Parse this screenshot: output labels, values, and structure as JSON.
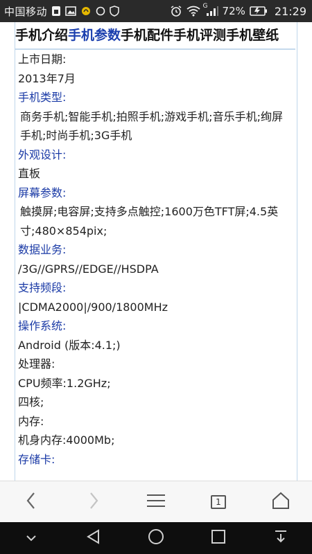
{
  "status_bar": {
    "carrier": "中国移动",
    "battery_percent": "72%",
    "time": "21:29",
    "network": "G",
    "icons": [
      "sim-icon",
      "gallery-icon",
      "app-icon",
      "circle-icon",
      "shield-icon",
      "alarm-icon",
      "wifi-icon",
      "signal-icon",
      "battery-icon"
    ]
  },
  "top_nav": {
    "items": [
      {
        "label": "手机介绍",
        "active": false
      },
      {
        "label": "手机参数",
        "active": true
      },
      {
        "label": "手机配件",
        "active": false
      },
      {
        "label": "手机评测",
        "active": false
      },
      {
        "label": "手机壁纸",
        "active": false
      }
    ]
  },
  "specs": [
    {
      "label": "上市日期:",
      "label_style": "plain",
      "value": "2013年7月"
    },
    {
      "label": "手机类型:",
      "label_style": "blue",
      "value": "商务手机;智能手机;拍照手机;游戏手机;音乐手机;绚屏手机;时尚手机;3G手机"
    },
    {
      "label": "外观设计:",
      "label_style": "blue",
      "value": "直板"
    },
    {
      "label": "屏幕参数:",
      "label_style": "blue",
      "value": "触摸屏;电容屏;支持多点触控;1600万色TFT屏;4.5英寸;480×854pix;"
    },
    {
      "label": "数据业务:",
      "label_style": "blue",
      "value": "/3G//GPRS//EDGE//HSDPA"
    },
    {
      "label": "支持频段:",
      "label_style": "blue",
      "value": "|CDMA2000|/900/1800MHz"
    },
    {
      "label": "操作系统:",
      "label_style": "blue",
      "value": "Android (版本:4.1;)"
    },
    {
      "label": "处理器:",
      "label_style": "plain",
      "value": "CPU频率:1.2GHz;"
    },
    {
      "label": "",
      "label_style": "plain",
      "value": "四核;"
    },
    {
      "label": "内存:",
      "label_style": "plain",
      "value": "机身内存:4000Mb;"
    },
    {
      "label": "存储卡:",
      "label_style": "blue",
      "value": ""
    }
  ],
  "toolbar": {
    "tab_count": "1",
    "buttons": [
      "back-icon",
      "forward-icon",
      "menu-icon",
      "tabs-icon",
      "home-icon"
    ]
  },
  "nav_bar": {
    "buttons": [
      "collapse-icon",
      "back-triangle-icon",
      "home-circle-icon",
      "recents-square-icon",
      "notification-pull-icon"
    ]
  },
  "colors": {
    "link_blue": "#1a3aa6",
    "status_bar_bg": "#2a2a2a",
    "nav_bar_bg": "#0e0e0e",
    "frame_border": "#bfd6ea"
  }
}
